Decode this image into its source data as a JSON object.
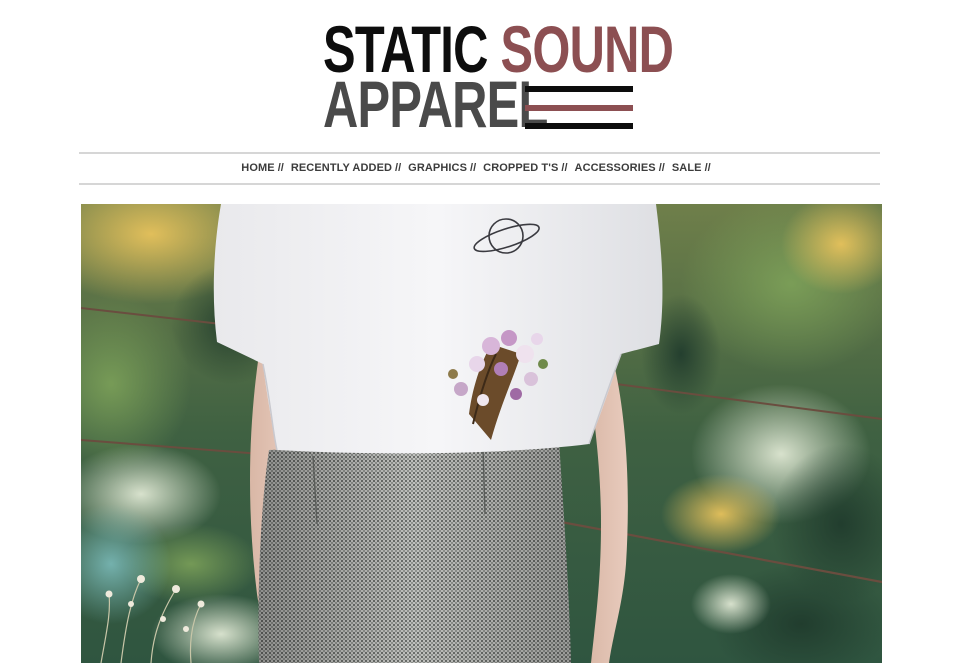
{
  "logo": {
    "line1_word1": "STATIC",
    "line1_word2": "SOUND",
    "line2_word": "APPAREL",
    "colors": {
      "black": "#0d0d0d",
      "maroon": "#8c4f52",
      "gray": "#4a4a4a"
    }
  },
  "nav": {
    "items": [
      {
        "label": "HOME",
        "sep": "//"
      },
      {
        "label": "RECENTLY ADDED",
        "sep": "//"
      },
      {
        "label": "GRAPHICS",
        "sep": "//"
      },
      {
        "label": "CROPPED T'S",
        "sep": "//"
      },
      {
        "label": "ACCESSORIES",
        "sep": "//"
      },
      {
        "label": "SALE",
        "sep": "//"
      }
    ]
  },
  "hero": {
    "image_subject": "model-white-cropped-tee-planet-graphic-houndstooth-skirt"
  }
}
